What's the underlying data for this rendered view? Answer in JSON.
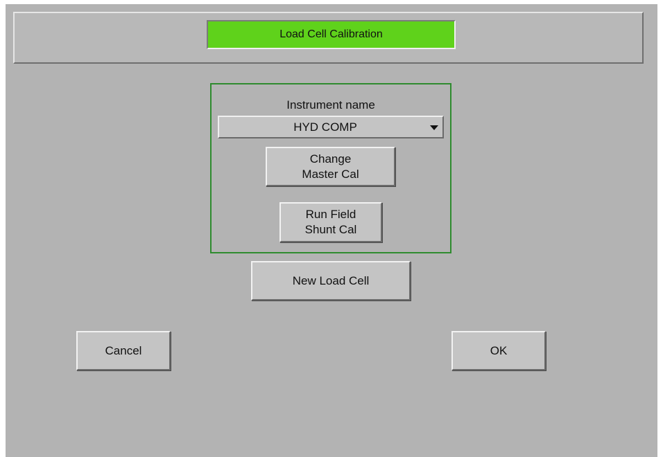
{
  "header": {
    "title": "Load Cell Calibration"
  },
  "instrument": {
    "label": "Instrument name",
    "selected": "HYD COMP"
  },
  "buttons": {
    "change_master_cal": "Change\nMaster Cal",
    "run_field_shunt_cal": "Run Field\nShunt Cal",
    "new_load_cell": "New Load Cell",
    "cancel": "Cancel",
    "ok": "OK"
  },
  "colors": {
    "title_bg": "#5fd21b",
    "group_border": "#2e8b2e",
    "panel_bg": "#b3b3b3"
  },
  "icons": {
    "dropdown_arrow": "chevron-down-icon"
  }
}
